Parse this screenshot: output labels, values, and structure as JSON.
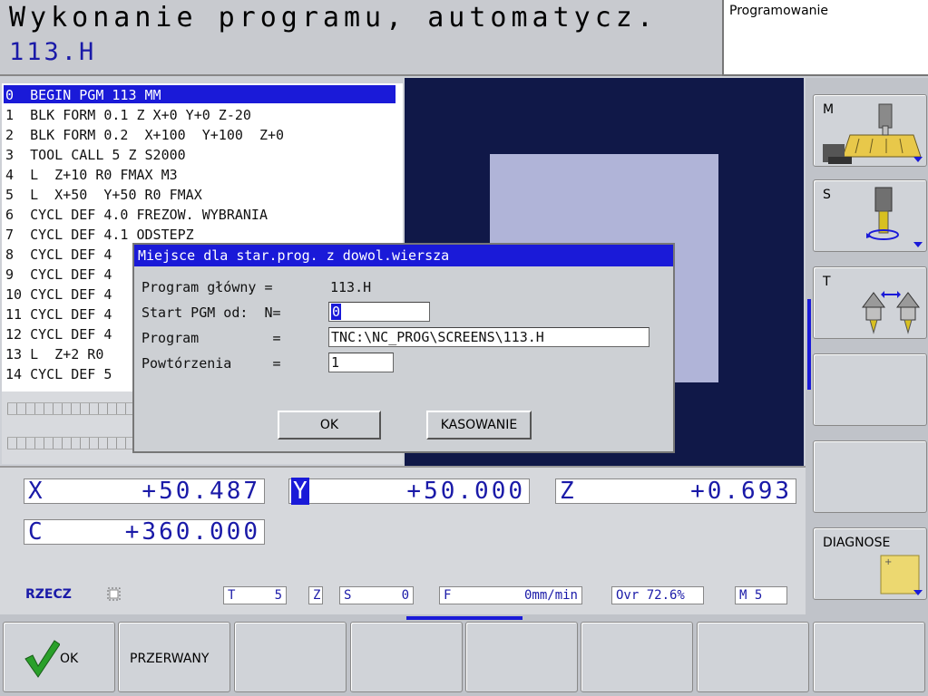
{
  "header": {
    "mode_title": "Wykonanie programu, automatycz.",
    "program_name": "113.H",
    "secondary_mode": "Programowanie"
  },
  "listing": [
    "0  BEGIN PGM 113 MM",
    "1  BLK FORM 0.1 Z X+0 Y+0 Z-20",
    "2  BLK FORM 0.2  X+100  Y+100  Z+0",
    "3  TOOL CALL 5 Z S2000",
    "4  L  Z+10 R0 FMAX M3",
    "5  L  X+50  Y+50 R0 FMAX",
    "6  CYCL DEF 4.0 FREZOW. WYBRANIA",
    "7  CYCL DEF 4.1 ODSTEPZ",
    "8  CYCL DEF 4",
    "9  CYCL DEF 4",
    "10 CYCL DEF 4",
    "11 CYCL DEF 4",
    "12 CYCL DEF 4",
    "13 L  Z+2 R0",
    "14 CYCL DEF 5"
  ],
  "dialog": {
    "title": "Miejsce dla star.prog. z dowol.wiersza",
    "main_program_label": "Program główny =",
    "main_program_value": "113.H",
    "start_label": "Start PGM od:  N=",
    "start_value": "0",
    "program_label": "Program         =",
    "program_value": "TNC:\\NC_PROG\\SCREENS\\113.H",
    "repeat_label": "Powtórzenia     =",
    "repeat_value": "1",
    "ok_label": "OK",
    "cancel_label": "KASOWANIE"
  },
  "positions": {
    "x_label": "X",
    "x_value": "+50.487",
    "y_label": "Y",
    "y_value": "+50.000",
    "z_label": "Z",
    "z_value": "+0.693",
    "c_label": "C",
    "c_value": "+360.000"
  },
  "status": {
    "mode": "RZECZ",
    "t_label": "T",
    "t_value": "5",
    "z_label": "Z",
    "s_label": "S",
    "s_value": "0",
    "f_label": "F",
    "f_value": "0mm/min",
    "ovr": "Ovr 72.6%",
    "m": "M 5"
  },
  "right_softkeys": {
    "m": "M",
    "s": "S",
    "t": "T",
    "diagnose": "DIAGNOSE"
  },
  "bottom_softkeys": {
    "ok": "OK",
    "interrupted": "PRZERWANY"
  },
  "colors": {
    "accent": "#1a1ad8",
    "graphics_bg": "#101848",
    "workpiece": "#b0b4d8",
    "ok_check": "#2aa02a"
  }
}
